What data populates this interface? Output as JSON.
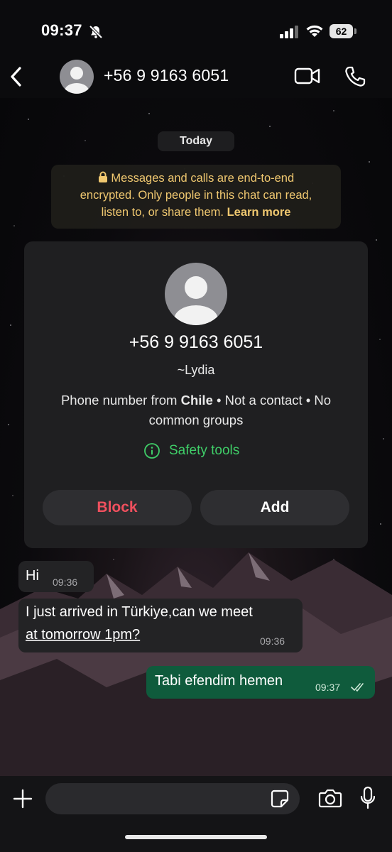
{
  "status_bar": {
    "time": "09:37",
    "battery": "62"
  },
  "header": {
    "contact_name": "+56 9 9163 6051"
  },
  "chat": {
    "date_label": "Today",
    "encryption_notice": {
      "line1": "Messages and calls are end-to-end",
      "line2": "encrypted. Only people in this chat can read,",
      "line3_text": "listen to, or share them. ",
      "learn_more": "Learn more"
    },
    "contact_card": {
      "number": "+56 9 9163 6051",
      "alias": "~Lydia",
      "info_prefix": "Phone number from ",
      "country": "Chile",
      "info_suffix": " • Not a contact • No common groups",
      "safety_tools": "Safety tools",
      "block_label": "Block",
      "add_label": "Add"
    },
    "messages": [
      {
        "direction": "incoming",
        "text": "Hi",
        "time": "09:36"
      },
      {
        "direction": "incoming",
        "line1": "I just arrived in Türkiye,can we meet",
        "line2": "at tomorrow 1pm?",
        "time": "09:36"
      },
      {
        "direction": "outgoing",
        "text": "Tabi efendim hemen",
        "time": "09:37",
        "status": "read"
      }
    ]
  },
  "input_bar": {
    "placeholder": ""
  },
  "colors": {
    "accent_green": "#3fce68",
    "block_red": "#f0505e",
    "outgoing_bubble": "#0f5b3c",
    "notice_text": "#f0c870"
  },
  "icons": [
    "bell-muted-icon",
    "signal-icon",
    "wifi-icon",
    "battery-icon",
    "back-icon",
    "video-call-icon",
    "phone-call-icon",
    "lock-icon",
    "info-icon",
    "plus-icon",
    "sticker-icon",
    "camera-icon",
    "mic-icon",
    "double-check-icon"
  ]
}
